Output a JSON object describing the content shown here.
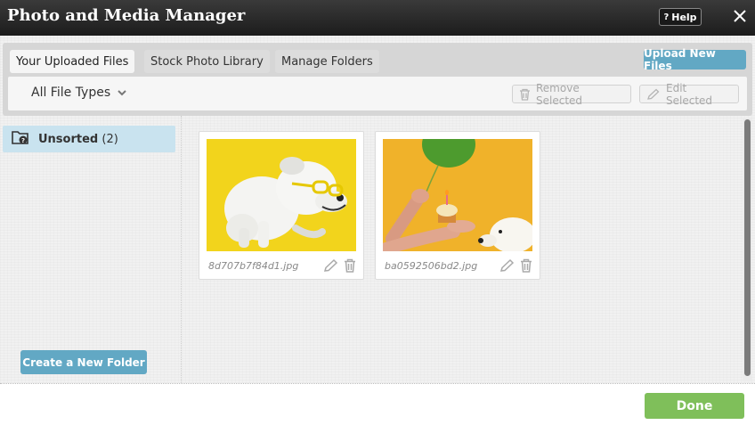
{
  "window": {
    "title": "Photo and Media Manager",
    "help_label": "Help",
    "help_icon": "?",
    "close_icon": "close-icon"
  },
  "tabs": [
    {
      "label": "Your Uploaded Files",
      "active": true
    },
    {
      "label": "Stock Photo Library",
      "active": false
    },
    {
      "label": "Manage Folders",
      "active": false
    }
  ],
  "toolbar": {
    "upload_label": "Upload New Files",
    "file_type": "All File Types",
    "remove_label": "Remove Selected",
    "edit_label": "Edit Selected"
  },
  "sidebar": {
    "folders": [
      {
        "name": "Unsorted",
        "count": "(2)",
        "icon": "folder-question-icon"
      }
    ],
    "create_folder_label": "Create a New Folder"
  },
  "files": [
    {
      "filename": "8d707b7f84d1.jpg",
      "thumbnail": "dog-with-glasses"
    },
    {
      "filename": "ba0592506bd2.jpg",
      "thumbnail": "dog-birthday-cupcake"
    }
  ],
  "footer": {
    "done_label": "Done"
  },
  "colors": {
    "accent": "#62a8c4",
    "done": "#7fbf5a",
    "selected_folder": "#c9e3ef",
    "titlebar": "#262626"
  }
}
